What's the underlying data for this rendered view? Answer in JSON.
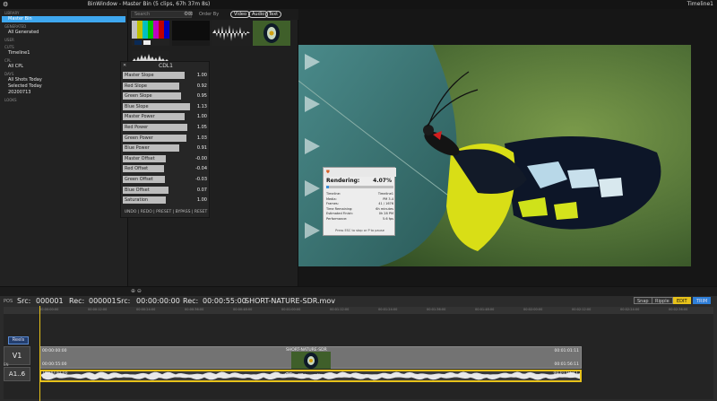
{
  "window": {
    "title": "BinWindow - Master Bin (5 clips, 67h 37m 8s)",
    "right_title": "Timeline1"
  },
  "sidebar": {
    "sections": [
      {
        "header": "LIBRARY",
        "items": [
          {
            "label": "Master Bin",
            "selected": true
          }
        ]
      },
      {
        "header": "GENERATED",
        "items": [
          {
            "label": "All Generated"
          }
        ]
      },
      {
        "header": "USER",
        "items": []
      },
      {
        "header": "CUTS",
        "items": [
          {
            "label": "Timeline1"
          }
        ]
      },
      {
        "header": "CPL",
        "items": [
          {
            "label": "All CPL"
          }
        ]
      },
      {
        "header": "DAYS",
        "items": [
          {
            "label": "All Shots Today"
          },
          {
            "label": "Selected Today"
          },
          {
            "label": "20200713"
          }
        ]
      },
      {
        "header": "LOOKS",
        "items": []
      }
    ]
  },
  "bin": {
    "search_placeholder": "Search",
    "order_by": "Order By",
    "filters": [
      "Video",
      "Audio",
      "Text"
    ]
  },
  "cdl": {
    "title": "CDL1",
    "rows": [
      {
        "label": "Master Slope",
        "value": "1.00",
        "fill": 0.72
      },
      {
        "label": "Red Slope",
        "value": "0.92",
        "fill": 0.66
      },
      {
        "label": "Green Slope",
        "value": "0.95",
        "fill": 0.68
      },
      {
        "label": "Blue Slope",
        "value": "1.13",
        "fill": 0.78
      },
      {
        "label": "Master Power",
        "value": "1.00",
        "fill": 0.72
      },
      {
        "label": "Red Power",
        "value": "1.05",
        "fill": 0.75
      },
      {
        "label": "Green Power",
        "value": "1.03",
        "fill": 0.74
      },
      {
        "label": "Blue Power",
        "value": "0.91",
        "fill": 0.66
      },
      {
        "label": "Master Offset",
        "value": "-0.00",
        "fill": 0.5
      },
      {
        "label": "Red Offset",
        "value": "-0.04",
        "fill": 0.48
      },
      {
        "label": "Green Offset",
        "value": "-0.03",
        "fill": 0.49
      },
      {
        "label": "Blue Offset",
        "value": "0.07",
        "fill": 0.53
      },
      {
        "label": "Saturation",
        "value": "1.00",
        "fill": 0.5
      }
    ],
    "footer": "UNDO | REDO | PRESET | BYPASS | RESET"
  },
  "render": {
    "title": "Rendering:",
    "percent": "4.07%",
    "progress": 0.0407,
    "fields": [
      {
        "k": "Timeline:",
        "v": "Timeline1"
      },
      {
        "k": "Media:",
        "v": "PM 3.4"
      },
      {
        "k": "Frames:",
        "v": "41 / 1676"
      },
      {
        "k": "Time Remaining:",
        "v": "6h minutes"
      },
      {
        "k": "Estimated Finish:",
        "v": "0h 28 PM"
      },
      {
        "k": "Performance:",
        "v": "5.6 fps"
      }
    ],
    "hint": "Press ESC to stop or P to pause"
  },
  "timeline": {
    "pos_label": "POS",
    "src1_label": "Src:",
    "src1_value": "000001",
    "rec1_label": "Rec:",
    "rec1_value": "000001",
    "src2_label": "Src:",
    "src2_value": "00:00:00:00",
    "rec2_label": "Rec:",
    "rec2_value": "00:00:55:00",
    "clip_file": "SHORT-NATURE-SDR.mov",
    "modes": [
      "Snap",
      "Ripple",
      "EDIT",
      "TRIM"
    ],
    "ruler": [
      "00:00:00:00",
      "00:00:12:00",
      "00:00:24:00",
      "00:00:36:00",
      "00:00:48:00",
      "00:01:00:00",
      "00:01:12:00",
      "00:01:24:00",
      "00:01:36:00",
      "00:01:48:00",
      "00:02:00:00",
      "00:02:12:00",
      "00:02:24:00",
      "00:02:36:00"
    ],
    "reels": "Reels",
    "v1": "V1",
    "a16": "A1..6",
    "en": "EN",
    "video_clip": {
      "name": "SHORT-NATURE-SDR",
      "src_in": "00:00:00:00",
      "src_out": "00:01:01:11",
      "rec_in": "00:00:55:00",
      "rec_out": "00:01:56:11"
    },
    "audio_clip": {
      "name": "SHORT-NATURE-SDR",
      "src_in": "00:00:00:00",
      "src_out": "00:01:01:11"
    }
  },
  "colors": {
    "accent": "#3fa8f0",
    "edit": "#e7c21a",
    "trim": "#2f7fd8",
    "render_icon": "#d9632a"
  }
}
